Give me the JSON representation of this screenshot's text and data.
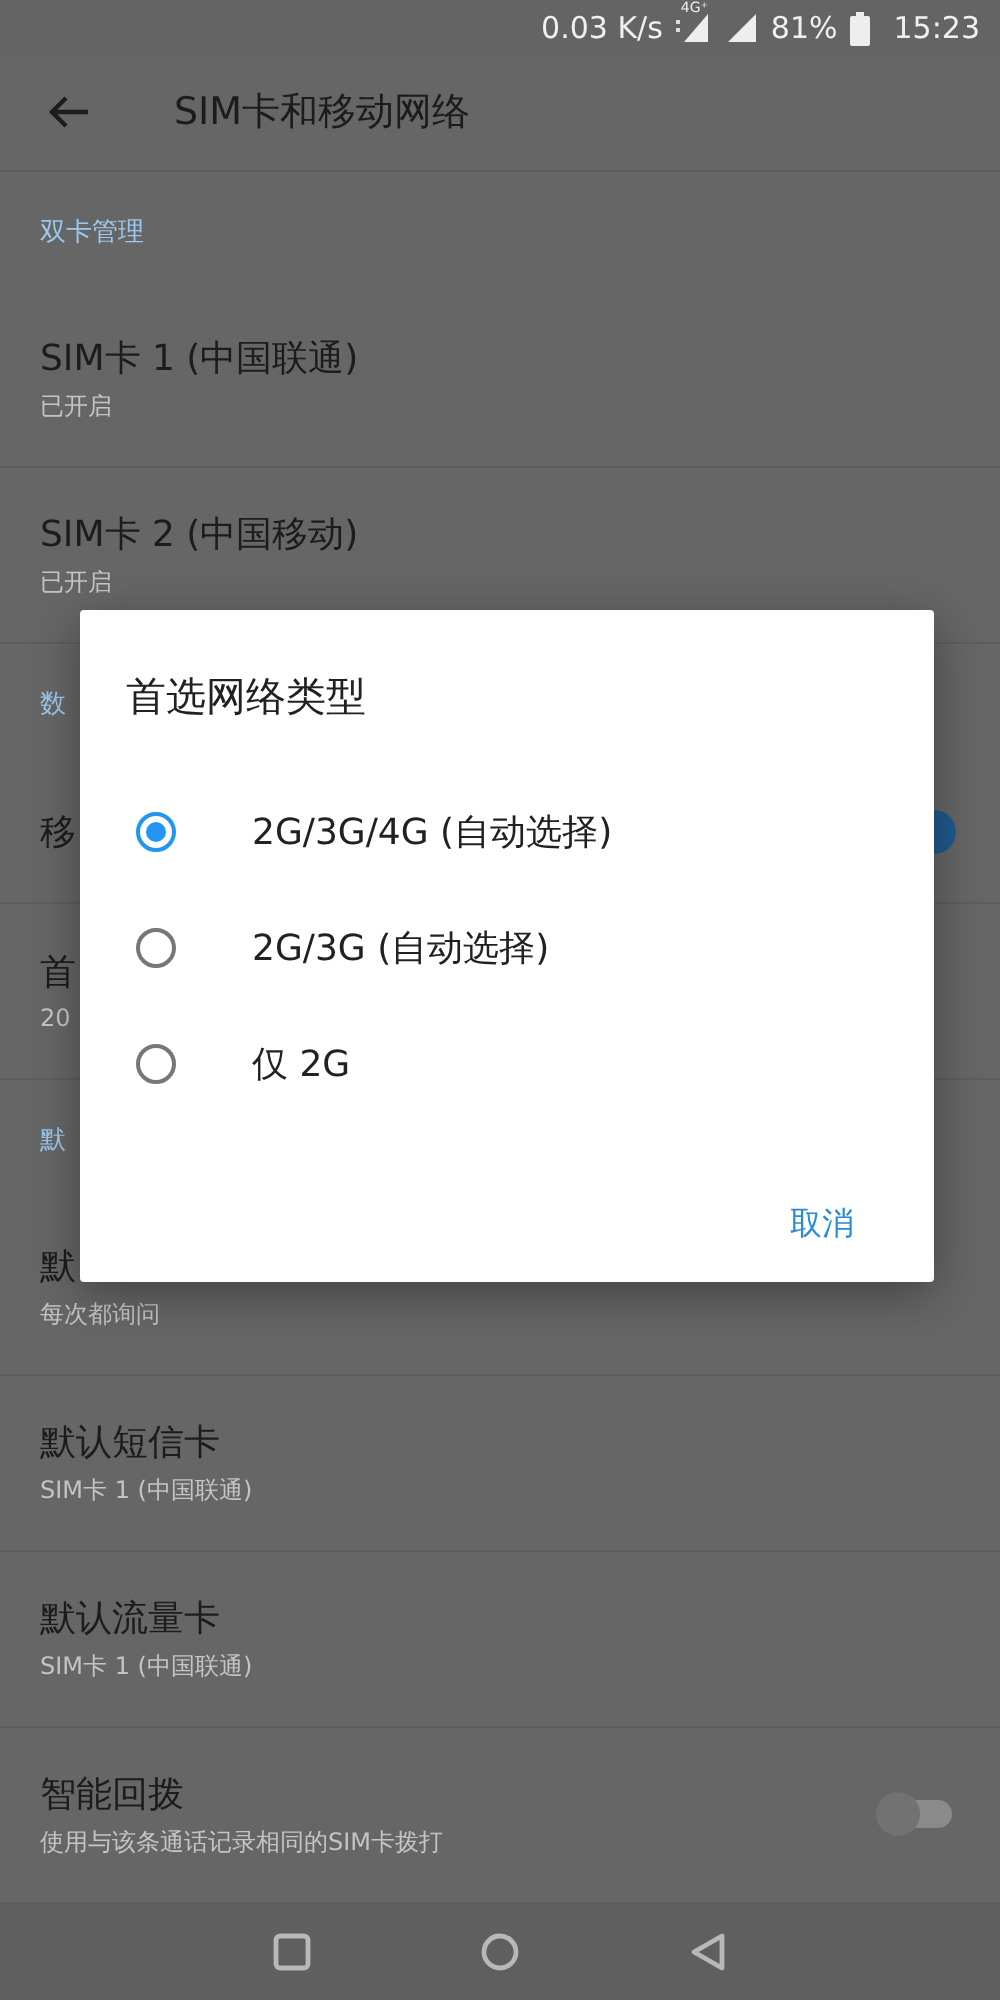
{
  "status_bar": {
    "net_speed": "0.03 K/s",
    "network_badge": "4G⁺",
    "battery": "81%",
    "time": "15:23"
  },
  "toolbar": {
    "title": "SIM卡和移动网络"
  },
  "list": [
    {
      "kind": "header",
      "title": "双卡管理"
    },
    {
      "kind": "row",
      "title": "SIM卡 1 (中国联通)",
      "subtitle": "已开启"
    },
    {
      "kind": "row",
      "title": "SIM卡 2 (中国移动)",
      "subtitle": "已开启"
    },
    {
      "kind": "header",
      "title": "数"
    },
    {
      "kind": "toggle",
      "title": "移",
      "on": true
    },
    {
      "kind": "row",
      "title": "首",
      "subtitle": "20"
    },
    {
      "kind": "header",
      "title": "默"
    },
    {
      "kind": "row",
      "title": "默",
      "subtitle": "每次都询问"
    },
    {
      "kind": "row",
      "title": "默认短信卡",
      "subtitle": "SIM卡 1 (中国联通)"
    },
    {
      "kind": "row",
      "title": "默认流量卡",
      "subtitle": "SIM卡 1 (中国联通)"
    },
    {
      "kind": "toggle",
      "title": "智能回拨",
      "subtitle": "使用与该条通话记录相同的SIM卡拨打",
      "on": false
    }
  ],
  "dialog": {
    "title": "首选网络类型",
    "options": [
      {
        "label": "2G/3G/4G (自动选择)",
        "selected": true
      },
      {
        "label": "2G/3G (自动选择)",
        "selected": false
      },
      {
        "label": "仅 2G",
        "selected": false
      }
    ],
    "buttons": [
      "取消"
    ]
  }
}
